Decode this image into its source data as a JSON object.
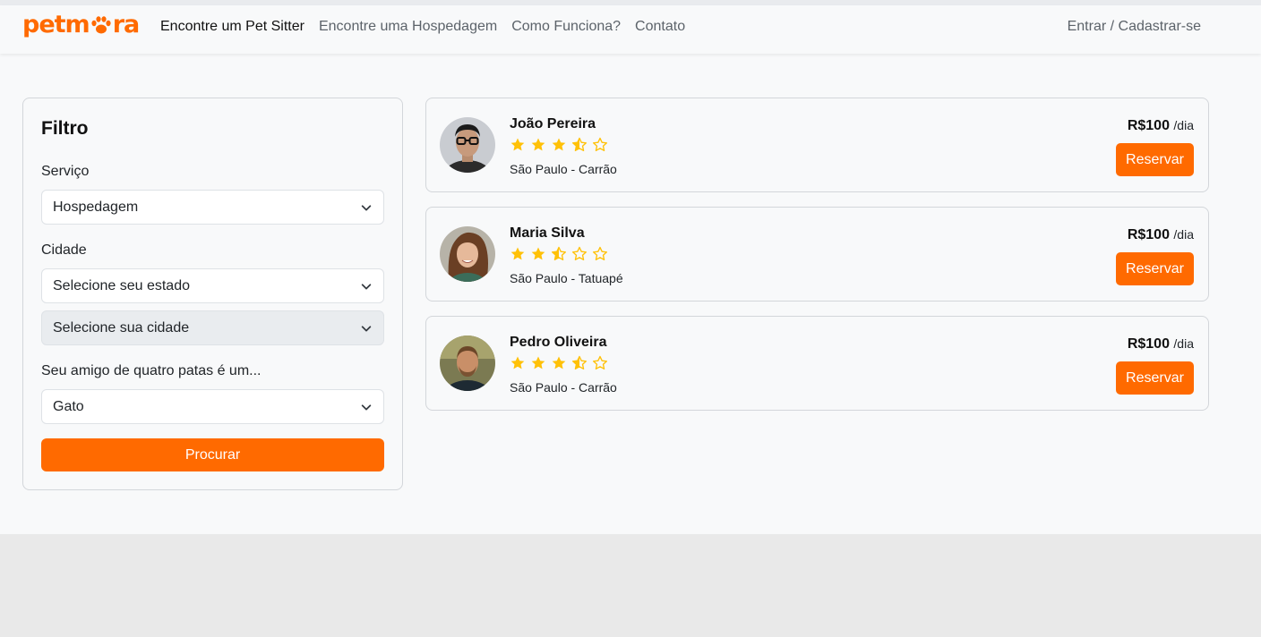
{
  "brand": {
    "logo_text_left": "petm",
    "logo_text_right": "ra",
    "accent_color": "#ff6a00"
  },
  "nav": {
    "links": [
      {
        "label": "Encontre um Pet Sitter",
        "active": true
      },
      {
        "label": "Encontre uma Hospedagem",
        "active": false
      },
      {
        "label": "Como Funciona?",
        "active": false
      },
      {
        "label": "Contato",
        "active": false
      }
    ],
    "login_label": "Entrar / Cadastrar-se"
  },
  "filter": {
    "title": "Filtro",
    "service_label": "Serviço",
    "service_value": "Hospedagem",
    "city_label": "Cidade",
    "state_placeholder": "Selecione seu estado",
    "city_placeholder": "Selecione sua cidade",
    "pet_label": "Seu amigo de quatro patas é um...",
    "pet_value": "Gato",
    "search_label": "Procurar"
  },
  "sitters": [
    {
      "name": "João Pereira",
      "rating": 3.5,
      "location": "São Paulo - Carrão",
      "price": "R$100",
      "unit": "/dia",
      "button": "Reservar"
    },
    {
      "name": "Maria Silva",
      "rating": 2.5,
      "location": "São Paulo - Tatuapé",
      "price": "R$100",
      "unit": "/dia",
      "button": "Reservar"
    },
    {
      "name": "Pedro Oliveira",
      "rating": 3.5,
      "location": "São Paulo - Carrão",
      "price": "R$100",
      "unit": "/dia",
      "button": "Reservar"
    }
  ]
}
